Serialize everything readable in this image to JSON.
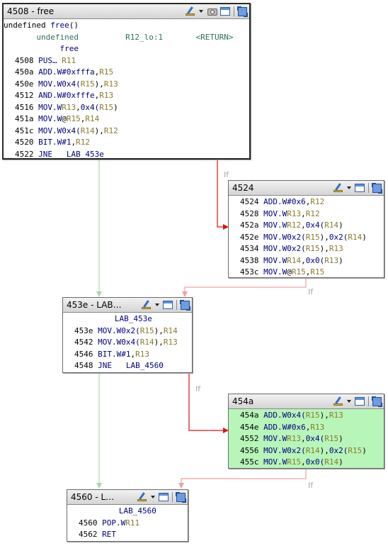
{
  "blocks": [
    {
      "title": "4508 - free",
      "header_lines": [
        {
          "parts": [
            {
              "t": "undefined ",
              "c": "tx"
            },
            {
              "t": "free",
              "c": "fn"
            },
            {
              "t": "()",
              "c": "tx"
            }
          ]
        },
        {
          "parts": [
            {
              "t": "       undefined          R12_lo:1       <RETURN>",
              "c": "gn"
            }
          ]
        },
        {
          "parts": [
            {
              "t": "            free",
              "c": "fn"
            }
          ]
        }
      ],
      "lines": [
        {
          "addr": "4508",
          "mn": "PUS…",
          "ops": [
            {
              "t": " ",
              "c": "sc"
            },
            {
              "t": "R11",
              "c": "reg"
            }
          ]
        },
        {
          "addr": "450a",
          "mn": "ADD.W",
          "ops": [
            {
              "t": "#0xfffa",
              "c": "op"
            },
            {
              "t": ",",
              "c": "sc"
            },
            {
              "t": "R15",
              "c": "reg"
            }
          ]
        },
        {
          "addr": "450e",
          "mn": "MOV.W",
          "ops": [
            {
              "t": "0x4(",
              "c": "op"
            },
            {
              "t": "R15",
              "c": "reg"
            },
            {
              "t": "),",
              "c": "sc"
            },
            {
              "t": "R13",
              "c": "reg"
            }
          ]
        },
        {
          "addr": "4512",
          "mn": "AND.W",
          "ops": [
            {
              "t": "#0xfffe",
              "c": "op"
            },
            {
              "t": ",",
              "c": "sc"
            },
            {
              "t": "R13",
              "c": "reg"
            }
          ]
        },
        {
          "addr": "4516",
          "mn": "MOV.W",
          "ops": [
            {
              "t": "R13",
              "c": "reg"
            },
            {
              "t": ",",
              "c": "sc"
            },
            {
              "t": "0x4(",
              "c": "op"
            },
            {
              "t": "R15",
              "c": "reg"
            },
            {
              "t": ")",
              "c": "sc"
            }
          ]
        },
        {
          "addr": "451a",
          "mn": "MOV.W",
          "ops": [
            {
              "t": "@",
              "c": "sc"
            },
            {
              "t": "R15",
              "c": "reg"
            },
            {
              "t": ",",
              "c": "sc"
            },
            {
              "t": "R14",
              "c": "reg"
            }
          ]
        },
        {
          "addr": "451c",
          "mn": "MOV.W",
          "ops": [
            {
              "t": "0x4(",
              "c": "op"
            },
            {
              "t": "R14",
              "c": "reg"
            },
            {
              "t": "),",
              "c": "sc"
            },
            {
              "t": "R12",
              "c": "reg"
            }
          ]
        },
        {
          "addr": "4520",
          "mn": "BIT.W",
          "ops": [
            {
              "t": "#1",
              "c": "op"
            },
            {
              "t": ",",
              "c": "sc"
            },
            {
              "t": "R12",
              "c": "reg"
            }
          ]
        },
        {
          "addr": "4522",
          "mn": "JNE",
          "ops": [
            {
              "t": "   LAB_453e",
              "c": "lbl"
            }
          ]
        }
      ]
    },
    {
      "title": "4524",
      "header_lines": [],
      "lines": [
        {
          "addr": "4524",
          "mn": "ADD.W",
          "ops": [
            {
              "t": "#0x6",
              "c": "op"
            },
            {
              "t": ",",
              "c": "sc"
            },
            {
              "t": "R12",
              "c": "reg"
            }
          ]
        },
        {
          "addr": "4528",
          "mn": "MOV.W",
          "ops": [
            {
              "t": "R13",
              "c": "reg"
            },
            {
              "t": ",",
              "c": "sc"
            },
            {
              "t": "R12",
              "c": "reg"
            }
          ]
        },
        {
          "addr": "452a",
          "mn": "MOV.W",
          "ops": [
            {
              "t": "R12",
              "c": "reg"
            },
            {
              "t": ",",
              "c": "sc"
            },
            {
              "t": "0x4(",
              "c": "op"
            },
            {
              "t": "R14",
              "c": "reg"
            },
            {
              "t": ")",
              "c": "sc"
            }
          ]
        },
        {
          "addr": "452e",
          "mn": "MOV.W",
          "ops": [
            {
              "t": "0x2(",
              "c": "op"
            },
            {
              "t": "R15",
              "c": "reg"
            },
            {
              "t": "),",
              "c": "sc"
            },
            {
              "t": "0x2(",
              "c": "op"
            },
            {
              "t": "R14",
              "c": "reg"
            },
            {
              "t": ")",
              "c": "sc"
            }
          ]
        },
        {
          "addr": "4534",
          "mn": "MOV.W",
          "ops": [
            {
              "t": "0x2(",
              "c": "op"
            },
            {
              "t": "R15",
              "c": "reg"
            },
            {
              "t": "),",
              "c": "sc"
            },
            {
              "t": "R13",
              "c": "reg"
            }
          ]
        },
        {
          "addr": "4538",
          "mn": "MOV.W",
          "ops": [
            {
              "t": "R14",
              "c": "reg"
            },
            {
              "t": ",",
              "c": "sc"
            },
            {
              "t": "0x0(",
              "c": "op"
            },
            {
              "t": "R13",
              "c": "reg"
            },
            {
              "t": ")",
              "c": "sc"
            }
          ]
        },
        {
          "addr": "453c",
          "mn": "MOV.W",
          "ops": [
            {
              "t": "@",
              "c": "sc"
            },
            {
              "t": "R15",
              "c": "reg"
            },
            {
              "t": ",",
              "c": "sc"
            },
            {
              "t": "R15",
              "c": "reg"
            }
          ]
        }
      ]
    },
    {
      "title": "453e - LAB…",
      "header_lines": [
        {
          "parts": [
            {
              "t": "           LAB_453e",
              "c": "lbl"
            }
          ]
        }
      ],
      "lines": [
        {
          "addr": "453e",
          "mn": "MOV.W",
          "ops": [
            {
              "t": "0x2(",
              "c": "op"
            },
            {
              "t": "R15",
              "c": "reg"
            },
            {
              "t": "),",
              "c": "sc"
            },
            {
              "t": "R14",
              "c": "reg"
            }
          ]
        },
        {
          "addr": "4542",
          "mn": "MOV.W",
          "ops": [
            {
              "t": "0x4(",
              "c": "op"
            },
            {
              "t": "R14",
              "c": "reg"
            },
            {
              "t": "),",
              "c": "sc"
            },
            {
              "t": "R13",
              "c": "reg"
            }
          ]
        },
        {
          "addr": "4546",
          "mn": "BIT.W",
          "ops": [
            {
              "t": "#1",
              "c": "op"
            },
            {
              "t": ",",
              "c": "sc"
            },
            {
              "t": "R13",
              "c": "reg"
            }
          ]
        },
        {
          "addr": "4548",
          "mn": "JNE",
          "ops": [
            {
              "t": "   LAB_4560",
              "c": "lbl"
            }
          ]
        }
      ]
    },
    {
      "title": "454a",
      "header_lines": [],
      "lines": [
        {
          "addr": "454a",
          "mn": "ADD.W",
          "ops": [
            {
              "t": "0x4(",
              "c": "op"
            },
            {
              "t": "R15",
              "c": "reg"
            },
            {
              "t": "),",
              "c": "sc"
            },
            {
              "t": "R13",
              "c": "reg"
            }
          ]
        },
        {
          "addr": "454e",
          "mn": "ADD.W",
          "ops": [
            {
              "t": "#0x6",
              "c": "op"
            },
            {
              "t": ",",
              "c": "sc"
            },
            {
              "t": "R13",
              "c": "reg"
            }
          ]
        },
        {
          "addr": "4552",
          "mn": "MOV.W",
          "ops": [
            {
              "t": "R13",
              "c": "reg"
            },
            {
              "t": ",",
              "c": "sc"
            },
            {
              "t": "0x4(",
              "c": "op"
            },
            {
              "t": "R15",
              "c": "reg"
            },
            {
              "t": ")",
              "c": "sc"
            }
          ]
        },
        {
          "addr": "4556",
          "mn": "MOV.W",
          "ops": [
            {
              "t": "0x2(",
              "c": "op"
            },
            {
              "t": "R14",
              "c": "reg"
            },
            {
              "t": "),",
              "c": "sc"
            },
            {
              "t": "0x2(",
              "c": "op"
            },
            {
              "t": "R15",
              "c": "reg"
            },
            {
              "t": ")",
              "c": "sc"
            }
          ]
        },
        {
          "addr": "455c",
          "mn": "MOV.W",
          "ops": [
            {
              "t": "R15",
              "c": "reg"
            },
            {
              "t": ",",
              "c": "sc"
            },
            {
              "t": "0x0(",
              "c": "op"
            },
            {
              "t": "R14",
              "c": "reg"
            },
            {
              "t": ")",
              "c": "sc"
            }
          ]
        }
      ]
    },
    {
      "title": "4560 - L…",
      "header_lines": [
        {
          "parts": [
            {
              "t": "           LAB_4560",
              "c": "lbl"
            }
          ]
        }
      ],
      "lines": [
        {
          "addr": "4560",
          "mn": "POP.W",
          "ops": [
            {
              "t": "R11",
              "c": "reg"
            }
          ]
        },
        {
          "addr": "4562",
          "mn": "RET",
          "ops": []
        }
      ]
    }
  ],
  "edge_labels": [
    "If",
    "If",
    "If",
    "If"
  ],
  "colors": {
    "edge_true": "#e01010",
    "edge_fall": "#a8d8a8",
    "edge_join": "#f0a0a0",
    "highlight_block": "#b8f5b8"
  },
  "icons": [
    "edit-icon",
    "dropdown-icon",
    "snapshot-icon",
    "window-icon",
    "maximize-icon"
  ]
}
